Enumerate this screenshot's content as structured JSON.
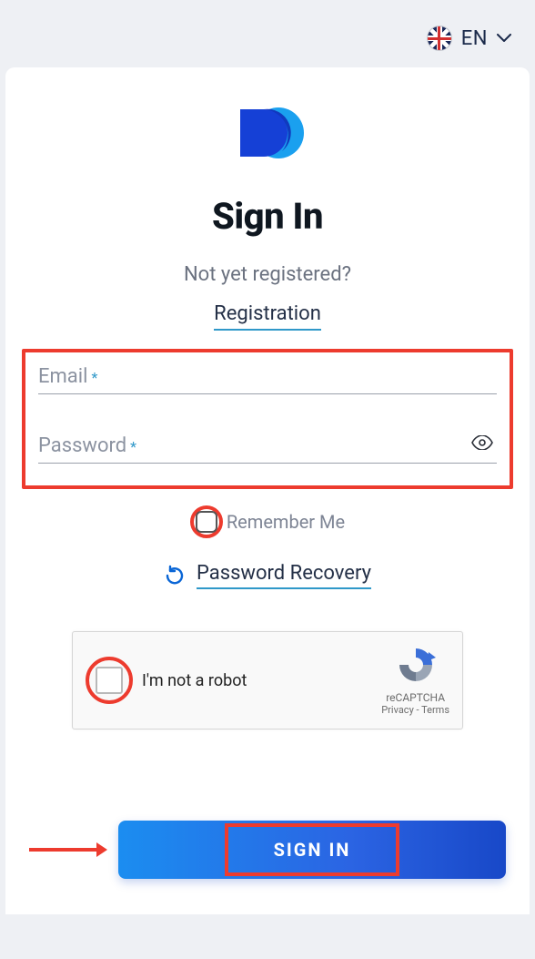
{
  "language": {
    "code": "EN"
  },
  "title": "Sign In",
  "subtitle": "Not yet registered?",
  "registration_link": "Registration",
  "fields": {
    "email_label": "Email",
    "password_label": "Password",
    "required_mark": "*"
  },
  "remember_label": "Remember Me",
  "recovery_link": "Password Recovery",
  "captcha": {
    "label": "I'm not a robot",
    "brand": "reCAPTCHA",
    "privacy": "Privacy",
    "sep": " - ",
    "terms": "Terms"
  },
  "button_label": "SIGN IN"
}
